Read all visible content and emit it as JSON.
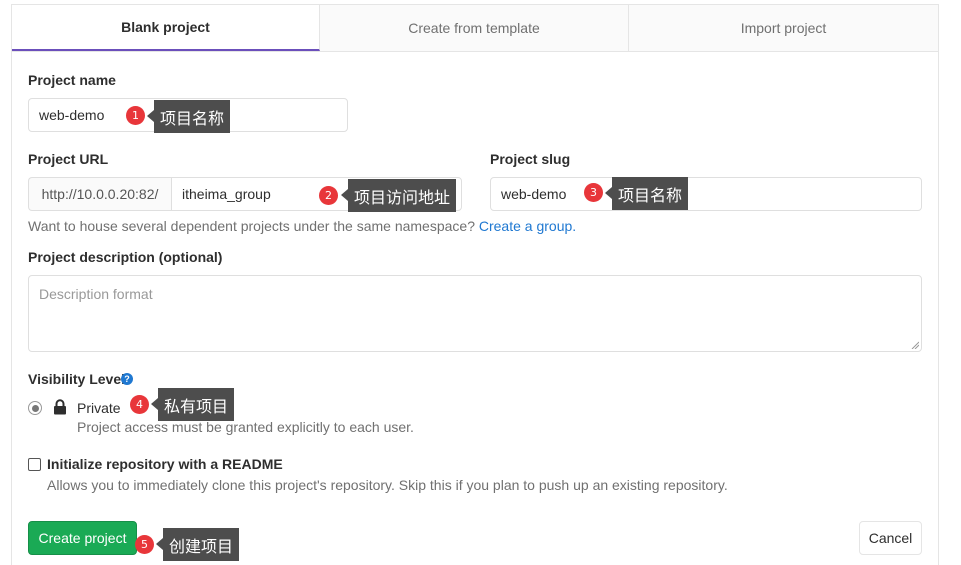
{
  "tabs": [
    {
      "label": "Blank project",
      "active": true
    },
    {
      "label": "Create from template",
      "active": false
    },
    {
      "label": "Import project",
      "active": false
    }
  ],
  "project_name": {
    "label": "Project name",
    "value": "web-demo"
  },
  "project_url": {
    "label": "Project URL",
    "prefix": "http://10.0.0.20:82/",
    "namespace": "itheima_group"
  },
  "project_slug": {
    "label": "Project slug",
    "value": "web-demo"
  },
  "namespace_help": {
    "text": "Want to house several dependent projects under the same namespace?",
    "link": "Create a group."
  },
  "description": {
    "label": "Project description (optional)",
    "placeholder": "Description format"
  },
  "visibility": {
    "label": "Visibility Level",
    "help_icon": "question-circle-icon",
    "option": {
      "label": "Private",
      "description": "Project access must be granted explicitly to each user.",
      "icon": "lock-icon",
      "selected": true
    }
  },
  "readme": {
    "label": "Initialize repository with a README",
    "description": "Allows you to immediately clone this project's repository. Skip this if you plan to push up an existing repository.",
    "checked": false
  },
  "buttons": {
    "create": "Create project",
    "cancel": "Cancel"
  },
  "annotations": [
    {
      "number": "1",
      "text": "项目名称"
    },
    {
      "number": "2",
      "text": "项目访问地址"
    },
    {
      "number": "3",
      "text": "项目名称"
    },
    {
      "number": "4",
      "text": "私有项目"
    },
    {
      "number": "5",
      "text": "创建项目"
    }
  ],
  "colors": {
    "accent": "#6b4fbb",
    "success": "#1aaa55",
    "link": "#1f78d1",
    "badge": "#e8363a",
    "callout": "#4d4d4d"
  }
}
